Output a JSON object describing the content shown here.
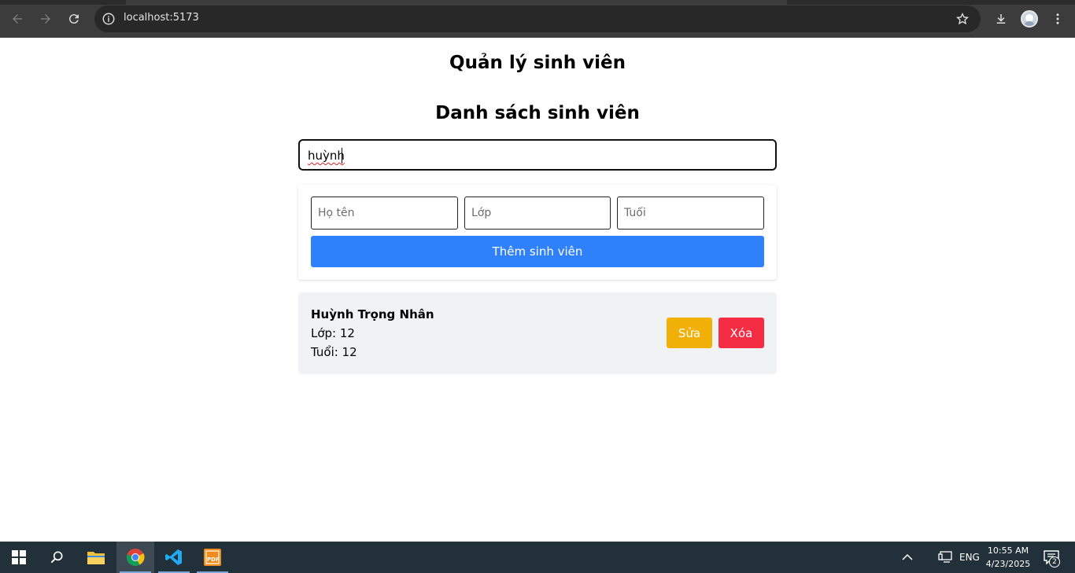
{
  "browser": {
    "url": "localhost:5173"
  },
  "app": {
    "title": "Quản lý sinh viên",
    "list_title": "Danh sách sinh viên"
  },
  "search": {
    "value": "huỳnh"
  },
  "form": {
    "name_placeholder": "Họ tên",
    "class_placeholder": "Lớp",
    "age_placeholder": "Tuổi",
    "add_label": "Thêm sinh viên"
  },
  "students": [
    {
      "name": "Huỳnh Trọng Nhân",
      "class_line": "Lớp: 12",
      "age_line": "Tuổi: 12",
      "edit_label": "Sửa",
      "delete_label": "Xóa"
    }
  ],
  "colors": {
    "primary": "#2f80fb",
    "warning": "#f1b007",
    "danger": "#f42d44"
  },
  "taskbar": {
    "language": "ENG",
    "time": "10:55 AM",
    "date": "4/23/2025",
    "notifications": "2"
  }
}
